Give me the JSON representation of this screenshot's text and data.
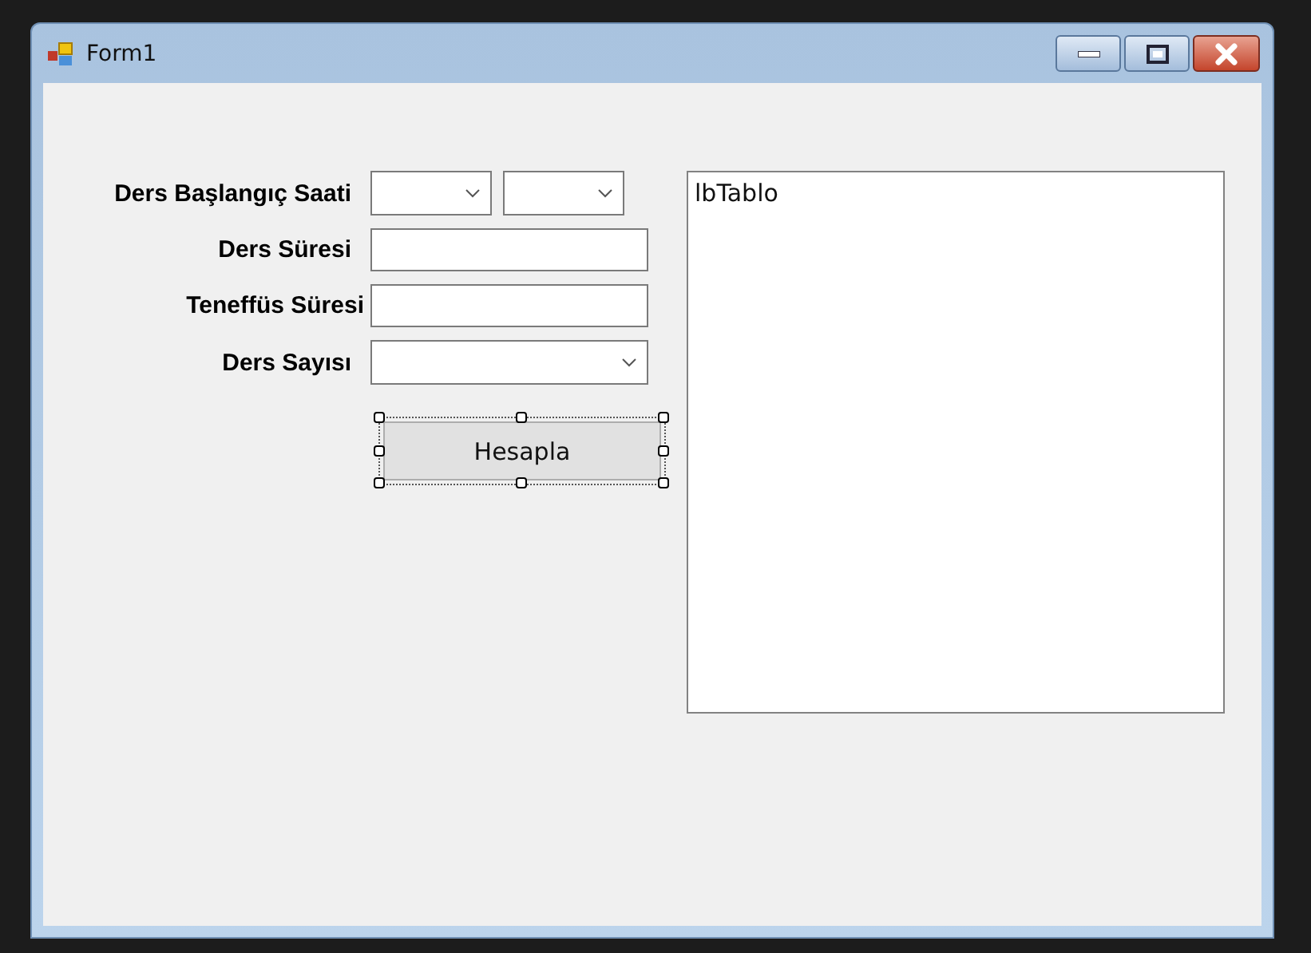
{
  "window": {
    "title": "Form1"
  },
  "fields": [
    {
      "label": "Ders Başlangıç Saati",
      "controls": [
        {
          "kind": "combo"
        },
        {
          "kind": "combo"
        }
      ]
    },
    {
      "label": "Ders Süresi",
      "controls": [
        {
          "kind": "text"
        }
      ]
    },
    {
      "label": "Teneffüs Süresi",
      "controls": [
        {
          "kind": "text"
        }
      ]
    },
    {
      "label": "Ders Sayısı",
      "controls": [
        {
          "kind": "combo"
        }
      ]
    }
  ],
  "button": {
    "label": "Hesapla",
    "selected": true
  },
  "listbox": {
    "items": [
      "lbTablo"
    ]
  }
}
